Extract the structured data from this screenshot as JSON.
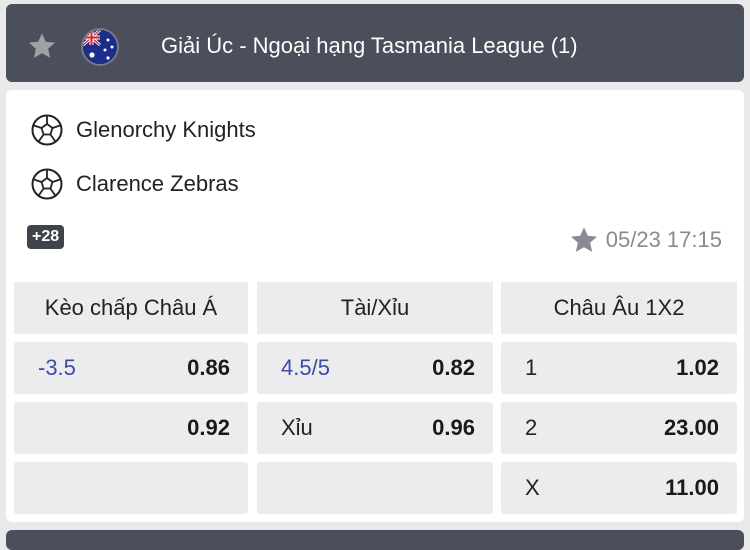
{
  "league": {
    "title": "Giải Úc - Ngoại hạng Tasmania League (1)",
    "flag_icon": "australia-flag-icon",
    "favorite_icon": "star-icon"
  },
  "match": {
    "home_team": "Glenorchy Knights",
    "away_team": "Clarence Zebras",
    "team_icon": "soccer-ball-icon",
    "more_markets": "+28",
    "datetime": "05/23 17:15"
  },
  "markets": {
    "asian_handicap": {
      "header": "Kèo chấp Châu Á",
      "rows": [
        {
          "label": "-3.5",
          "odd": "0.86"
        },
        {
          "label": "",
          "odd": "0.92"
        },
        {
          "label": "",
          "odd": ""
        }
      ]
    },
    "over_under": {
      "header": "Tài/Xỉu",
      "rows": [
        {
          "label": "4.5/5",
          "odd": "0.82"
        },
        {
          "label": "Xỉu",
          "odd": "0.96"
        },
        {
          "label": "",
          "odd": ""
        }
      ]
    },
    "european_1x2": {
      "header": "Châu Âu 1X2",
      "rows": [
        {
          "label": "1",
          "odd": "1.02"
        },
        {
          "label": "2",
          "odd": "23.00"
        },
        {
          "label": "X",
          "odd": "11.00"
        }
      ]
    }
  },
  "colors": {
    "header_bg": "#4b4f5c",
    "cell_bg": "#ececef",
    "handicap_blue": "#3f4aa6",
    "star_grey": "#a0a0a6"
  }
}
